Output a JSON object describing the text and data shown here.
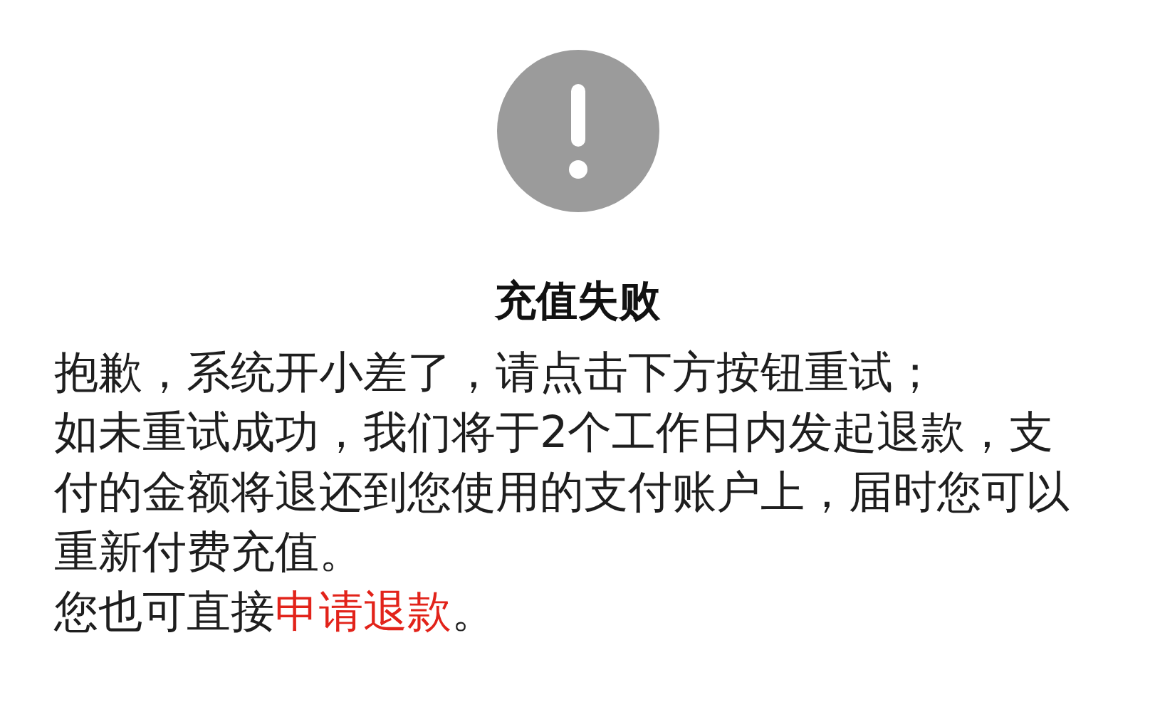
{
  "title": "充值失败",
  "paragraphs": [
    "抱歉，系统开小差了，请点击下方按钮重试；",
    "如未重试成功，我们将于2个工作日内发起退款，支付的金额将退还到您使用的支付账户上，届时您可以重新付费充值。"
  ],
  "refund_prompt": {
    "before": "您也可直接",
    "link": "申请退款",
    "after": "。"
  }
}
